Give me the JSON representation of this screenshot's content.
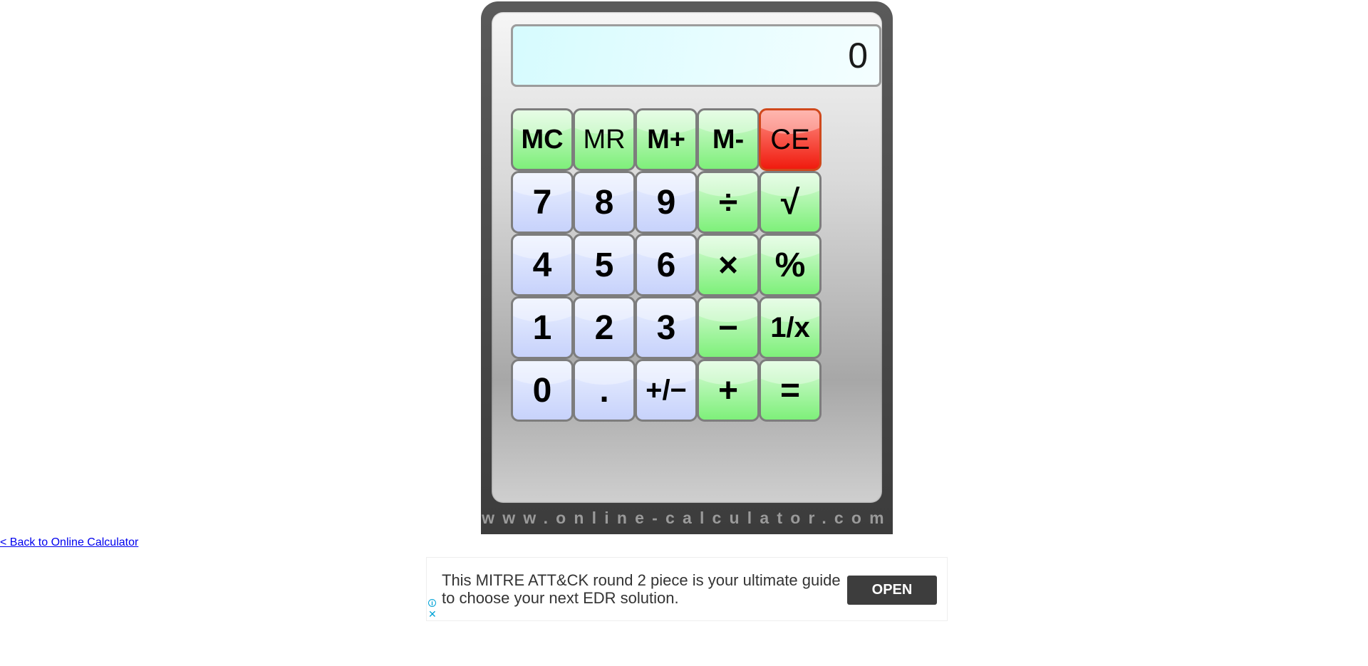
{
  "display": {
    "value": "0"
  },
  "keys": {
    "mc": "MC",
    "mr": "MR",
    "mplus": "M+",
    "mminus": "M-",
    "ce": "CE",
    "k7": "7",
    "k8": "8",
    "k9": "9",
    "divide": "÷",
    "sqrt": "√",
    "k4": "4",
    "k5": "5",
    "k6": "6",
    "multiply": "×",
    "percent": "%",
    "k1": "1",
    "k2": "2",
    "k3": "3",
    "minus": "−",
    "reciprocal": "1/x",
    "k0": "0",
    "dot": ".",
    "sign": "+/−",
    "plus": "+",
    "equals": "="
  },
  "brand": {
    "text": "www.online-calculator.com"
  },
  "back_link": {
    "label": "< Back to Online Calculator"
  },
  "ad": {
    "text": "This MITRE ATT&CK round 2 piece is your ultimate guide to choose your next EDR solution.",
    "open_label": "OPEN",
    "info_icon": "info-icon",
    "close_icon": "close-icon"
  },
  "colors": {
    "number_key": "#c7d2fb",
    "operator_key": "#7ef07a",
    "clear_key": "#f01b0e",
    "display_bg": "#d6fbfe",
    "body": "#3c3c3c"
  }
}
